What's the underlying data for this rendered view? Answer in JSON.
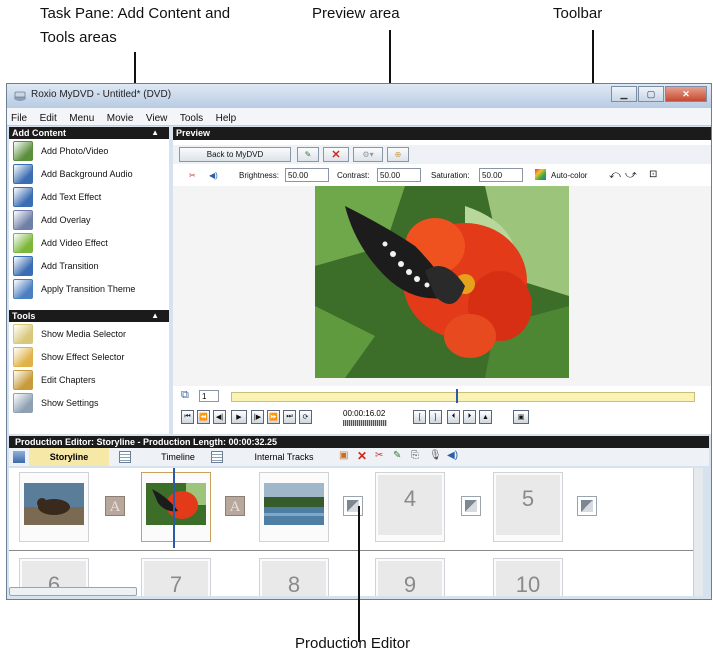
{
  "callouts": {
    "task_pane": "Task Pane: Add Content and\nTools areas",
    "preview": "Preview area",
    "toolbar": "Toolbar",
    "production_editor": "Production Editor"
  },
  "window": {
    "title": "Roxio MyDVD - Untitled* (DVD)"
  },
  "menu": [
    "File",
    "Edit",
    "Menu",
    "Movie",
    "View",
    "Tools",
    "Help"
  ],
  "add_content": {
    "header": "Add Content",
    "items": [
      {
        "label": "Add Photo/Video",
        "icon": "photo-video-icon",
        "color": "#5a8f3c"
      },
      {
        "label": "Add Background Audio",
        "icon": "audio-icon",
        "color": "#3b6db3"
      },
      {
        "label": "Add Text Effect",
        "icon": "text-effect-icon",
        "color": "#3b6db3"
      },
      {
        "label": "Add Overlay",
        "icon": "overlay-icon",
        "color": "#6f7fa8"
      },
      {
        "label": "Add Video Effect",
        "icon": "video-effect-icon",
        "color": "#7bb83a"
      },
      {
        "label": "Add Transition",
        "icon": "transition-icon",
        "color": "#3b6db3"
      },
      {
        "label": "Apply Transition Theme",
        "icon": "transition-theme-icon",
        "color": "#4a7fc0"
      }
    ]
  },
  "tools": {
    "header": "Tools",
    "items": [
      {
        "label": "Show Media Selector",
        "icon": "media-selector-icon",
        "color": "#d9c77a"
      },
      {
        "label": "Show Effect Selector",
        "icon": "effect-selector-icon",
        "color": "#e0b34a"
      },
      {
        "label": "Edit Chapters",
        "icon": "chapters-icon",
        "color": "#c79a3a"
      },
      {
        "label": "Show Settings",
        "icon": "settings-icon",
        "color": "#8fa0b3"
      }
    ]
  },
  "preview": {
    "header": "Preview",
    "back_button": "Back to MyDVD",
    "brightness_label": "Brightness:",
    "brightness_value": "50.00",
    "contrast_label": "Contrast:",
    "contrast_value": "50.00",
    "saturation_label": "Saturation:",
    "saturation_value": "50.00",
    "autocolor_label": "Auto-color",
    "frame_value": "1",
    "timecode": "00:00:16.02"
  },
  "production": {
    "header": "Production Editor: Storyline - Production Length: 00:00:32.25",
    "tabs": [
      "Storyline",
      "Timeline",
      "Internal Tracks"
    ],
    "slots": [
      "4",
      "5",
      "6",
      "7",
      "8",
      "9",
      "10"
    ]
  }
}
